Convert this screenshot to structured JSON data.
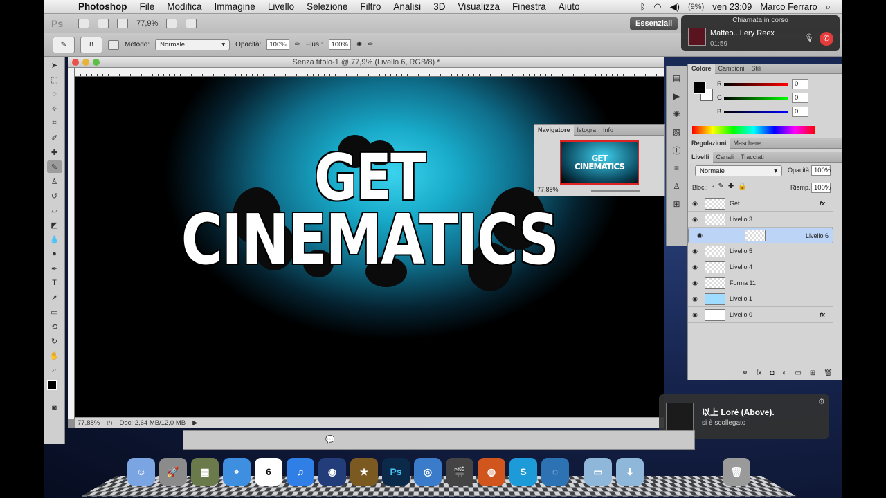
{
  "menubar": {
    "app": "Photoshop",
    "items": [
      "File",
      "Modifica",
      "Immagine",
      "Livello",
      "Selezione",
      "Filtro",
      "Analisi",
      "3D",
      "Visualizza",
      "Finestra",
      "Aiuto"
    ],
    "battery": "(9%)",
    "clock": "ven 23:09",
    "user": "Marco Ferraro"
  },
  "appbar": {
    "logo": "Ps",
    "zoom": "77,9%",
    "workspace": "Essenziali"
  },
  "options": {
    "brush_size": "8",
    "mode_label": "Metodo:",
    "mode_value": "Normale",
    "opacity_label": "Opacità:",
    "opacity_value": "100%",
    "flow_label": "Flus.:",
    "flow_value": "100%"
  },
  "document": {
    "title": "Senza titolo-1 @ 77,9% (Livello 6, RGB/8) *",
    "headline1": "GET",
    "headline2": "CINEMATICS",
    "status_zoom": "77,88%",
    "status_doc": "Doc: 2,64 MB/12,0 MB"
  },
  "navigator": {
    "tabs": [
      "Navigatore",
      "Istogra",
      "Info"
    ],
    "thumb_text1": "GET",
    "thumb_text2": "CINEMATICS",
    "zoom": "77,88%"
  },
  "color_panel": {
    "tabs": [
      "Colore",
      "Campioni",
      "Stili"
    ],
    "channels": [
      {
        "label": "R",
        "value": "0"
      },
      {
        "label": "G",
        "value": "0"
      },
      {
        "label": "B",
        "value": "0"
      }
    ]
  },
  "adjust_panel": {
    "tabs": [
      "Regolazioni",
      "Maschere"
    ]
  },
  "layers_panel": {
    "tabs": [
      "Livelli",
      "Canali",
      "Tracciati"
    ],
    "blend": "Normale",
    "opacity_label": "Opacità:",
    "opacity_value": "100%",
    "lock_label": "Bloc.:",
    "fill_label": "Riemp.:",
    "fill_value": "100%",
    "layers": [
      {
        "name": "Get",
        "fx": "fx"
      },
      {
        "name": "Livello 3",
        "fx": ""
      },
      {
        "name": "Livello 6",
        "fx": ""
      },
      {
        "name": "Livello 5",
        "fx": ""
      },
      {
        "name": "Livello 4",
        "fx": ""
      },
      {
        "name": "Forma 11",
        "fx": ""
      },
      {
        "name": "Livello 1",
        "fx": ""
      },
      {
        "name": "Livello 0",
        "fx": "fx"
      }
    ]
  },
  "call": {
    "header": "Chiamata in corso",
    "name": "Matteo...Lery Reex",
    "time": "01:59"
  },
  "notification": {
    "title": "以上 Lorè (Above).",
    "body": "si è scollegato"
  },
  "dock": {
    "calendar_day": "6",
    "apps": [
      "finder",
      "launchpad",
      "app-store",
      "safari",
      "calendar",
      "itunes",
      "cinema4d",
      "imovie",
      "photoshop",
      "preview",
      "final-cut",
      "firefox",
      "skype",
      "network",
      "folder",
      "downloads",
      "trash"
    ]
  },
  "colors": {
    "accent_red": "#d22222",
    "selected_layer": "#bcd4f5"
  }
}
